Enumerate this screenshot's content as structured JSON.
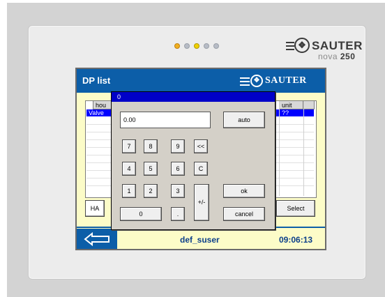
{
  "device": {
    "brand_name": "SAUTER",
    "brand_model_prefix": "nova",
    "brand_model_number": "250",
    "led_colors": [
      "#f0b020",
      "#b7bcc6",
      "#f0d000",
      "#b7bcc6",
      "#b7bcc6"
    ]
  },
  "screen": {
    "title": "DP list",
    "title_brand": "SAUTER",
    "columns": [
      "hou",
      "unit"
    ],
    "selected_row": {
      "name": "Valve",
      "unit": "??"
    },
    "ha_label": "HA",
    "select_label": "Select",
    "user": "def_suser",
    "time": "09:06:13"
  },
  "dialog": {
    "title": "0",
    "value": "0.00",
    "auto_label": "auto",
    "keys": {
      "k7": "7",
      "k8": "8",
      "k9": "9",
      "back": "<<",
      "k4": "4",
      "k5": "5",
      "k6": "6",
      "clear": "C",
      "k1": "1",
      "k2": "2",
      "k3": "3",
      "k0": "0",
      "dot": ".",
      "plusminus": "+/-"
    },
    "ok_label": "ok",
    "cancel_label": "cancel"
  },
  "colors": {
    "titlebar": "#0c5ea8",
    "screen_bg": "#fcfcc8",
    "dialog_title": "#0000c8",
    "selection": "#0000ff"
  }
}
